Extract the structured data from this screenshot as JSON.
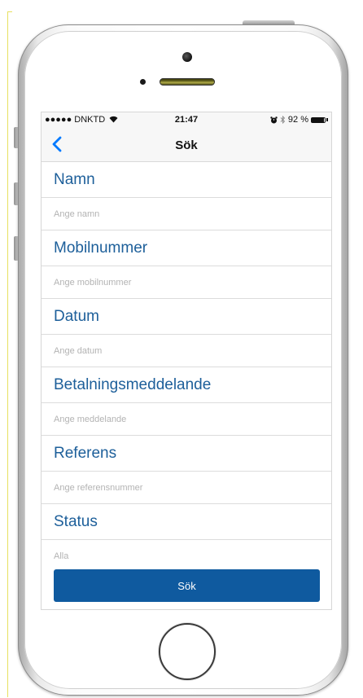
{
  "status_bar": {
    "carrier": "●●●●● DNKTD",
    "wifi_icon": "wifi-icon",
    "time": "21:47",
    "alarm_icon": "alarm-icon",
    "bluetooth_icon": "bluetooth-icon",
    "battery_percent_label": "92 %",
    "battery_level": 0.92
  },
  "nav": {
    "back_icon": "chevron-left-icon",
    "title": "Sök"
  },
  "form": {
    "fields": [
      {
        "label": "Namn",
        "placeholder": "Ange namn",
        "value": ""
      },
      {
        "label": "Mobilnummer",
        "placeholder": "Ange mobilnummer",
        "value": ""
      },
      {
        "label": "Datum",
        "placeholder": "Ange datum",
        "value": ""
      },
      {
        "label": "Betalningsmeddelande",
        "placeholder": "Ange meddelande",
        "value": ""
      },
      {
        "label": "Referens",
        "placeholder": "Ange referensnummer",
        "value": ""
      },
      {
        "label": "Status",
        "placeholder": "Alla",
        "value": ""
      }
    ]
  },
  "actions": {
    "search_label": "Sök"
  },
  "colors": {
    "accent": "#1d5f9a",
    "button": "#0f5a9f",
    "ios_blue": "#007aff"
  }
}
